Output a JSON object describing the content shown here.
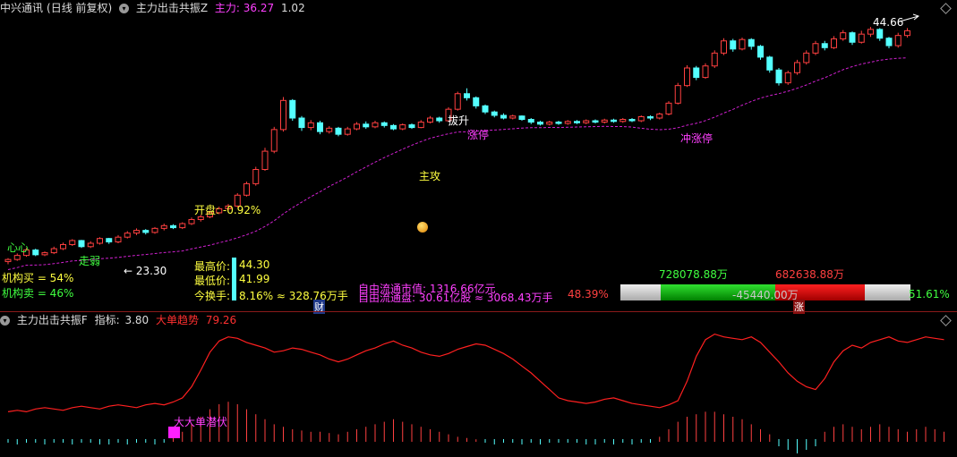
{
  "upper_header": {
    "stock": "中兴通讯",
    "period": "(日线 前复权)",
    "indicator": "主力出击共振Z",
    "line_label": "主力:",
    "line_value": "36.27",
    "ratio": "1.02"
  },
  "annotations": {
    "peak_price": "44.66",
    "low_price": "← 23.30",
    "xin": "心心",
    "zou_ruo": "走弱",
    "ba_sheng": "拔升",
    "zhang_ting_1": "涨停",
    "zhang_ting_2": "冲涨停",
    "zhu_gong": "主攻",
    "kai_pan": "开盘: -0.92%"
  },
  "info": {
    "inst_buy": "机构买 = 54%",
    "inst_sell": "机构卖 = 46%",
    "high_label": "最高价:",
    "high_value": "44.30",
    "low_label": "最低价:",
    "low_value": "41.99",
    "turnover_label": "今换手:",
    "turnover_value": "8.16% ≈ 328.76万手",
    "cai": "财",
    "float_cap": "自由流通市值: 1316.66亿元",
    "float_shares": "自由流通盘: 30.61亿股 ≈ 3068.43万手",
    "float_pct": "48.39%",
    "bar_green_value": "728078.88万",
    "bar_red_value": "682638.88万",
    "bar_center_value": "-45440.00万",
    "bar_pct": "51.61%",
    "zhang": "涨"
  },
  "lower_header": {
    "indicator": "主力出击共振F",
    "metric_label": "指标:",
    "metric_value": "3.80",
    "trend_label": "大单趋势",
    "trend_value": "79.26"
  },
  "lower_annotation": "大大单潜伏",
  "colors": {
    "up": "#ff4040",
    "down": "#54ffff",
    "ma": "#d020d0",
    "trend": "#ff2020",
    "yellow": "#ffff40",
    "magenta": "#ff40ff",
    "green": "#40ff40"
  },
  "candles": [
    [
      10.0,
      10.3,
      9.6,
      10.5
    ],
    [
      10.3,
      10.9,
      10.1,
      11.2
    ],
    [
      10.9,
      11.7,
      10.7,
      12.0
    ],
    [
      11.7,
      11.0,
      10.8,
      11.9
    ],
    [
      11.0,
      11.3,
      10.8,
      11.5
    ],
    [
      11.3,
      11.9,
      11.1,
      12.2
    ],
    [
      11.9,
      12.5,
      11.7,
      12.8
    ],
    [
      12.5,
      13.1,
      12.3,
      13.3
    ],
    [
      13.1,
      12.2,
      12.0,
      13.2
    ],
    [
      12.2,
      12.7,
      12.0,
      13.0
    ],
    [
      12.7,
      13.4,
      12.5,
      13.6
    ],
    [
      13.4,
      12.9,
      12.6,
      13.5
    ],
    [
      12.9,
      13.6,
      12.7,
      13.9
    ],
    [
      13.6,
      14.2,
      13.4,
      14.5
    ],
    [
      14.2,
      14.6,
      13.9,
      14.9
    ],
    [
      14.6,
      14.3,
      14.0,
      14.8
    ],
    [
      14.3,
      14.9,
      14.1,
      15.1
    ],
    [
      14.9,
      15.3,
      14.6,
      15.6
    ],
    [
      15.3,
      15.0,
      14.8,
      15.5
    ],
    [
      15.0,
      15.6,
      14.8,
      15.8
    ],
    [
      15.6,
      16.2,
      15.4,
      16.5
    ],
    [
      16.2,
      16.6,
      15.9,
      16.9
    ],
    [
      16.6,
      17.2,
      16.4,
      17.5
    ],
    [
      17.2,
      17.8,
      17.0,
      18.1
    ],
    [
      17.8,
      18.2,
      17.5,
      18.5
    ],
    [
      18.2,
      19.8,
      18.0,
      20.1
    ],
    [
      19.8,
      21.5,
      19.6,
      21.8
    ],
    [
      21.5,
      23.6,
      21.2,
      24.0
    ],
    [
      23.6,
      26.3,
      23.4,
      26.8
    ],
    [
      26.3,
      29.5,
      26.0,
      29.9
    ],
    [
      29.5,
      33.8,
      29.2,
      34.3
    ],
    [
      33.8,
      31.2,
      30.8,
      34.0
    ],
    [
      31.2,
      29.8,
      29.3,
      31.5
    ],
    [
      29.8,
      30.5,
      29.4,
      30.9
    ],
    [
      30.5,
      29.2,
      28.8,
      30.8
    ],
    [
      29.2,
      29.7,
      28.9,
      30.0
    ],
    [
      29.7,
      28.8,
      28.5,
      29.9
    ],
    [
      28.8,
      29.6,
      28.6,
      29.9
    ],
    [
      29.6,
      30.3,
      29.4,
      30.6
    ],
    [
      30.3,
      29.9,
      29.6,
      30.7
    ],
    [
      29.9,
      30.5,
      29.7,
      30.8
    ],
    [
      30.5,
      30.1,
      29.8,
      30.7
    ],
    [
      30.1,
      29.6,
      29.4,
      30.3
    ],
    [
      29.6,
      30.2,
      29.4,
      30.4
    ],
    [
      30.2,
      29.8,
      29.6,
      30.4
    ],
    [
      29.8,
      30.6,
      29.7,
      30.9
    ],
    [
      30.6,
      31.2,
      30.4,
      31.5
    ],
    [
      31.2,
      30.8,
      30.5,
      31.4
    ],
    [
      30.8,
      32.5,
      30.6,
      32.8
    ],
    [
      32.5,
      34.8,
      32.3,
      35.1
    ],
    [
      34.8,
      34.2,
      33.8,
      35.6
    ],
    [
      34.2,
      33.0,
      32.6,
      34.4
    ],
    [
      33.0,
      32.1,
      31.8,
      33.2
    ],
    [
      32.1,
      31.6,
      31.3,
      32.3
    ],
    [
      31.6,
      31.2,
      31.0,
      31.9
    ],
    [
      31.2,
      31.5,
      31.0,
      31.7
    ],
    [
      31.5,
      31.0,
      30.8,
      31.6
    ],
    [
      31.0,
      30.6,
      30.3,
      31.2
    ],
    [
      30.6,
      30.3,
      30.1,
      30.8
    ],
    [
      30.3,
      30.6,
      30.1,
      30.8
    ],
    [
      30.6,
      30.4,
      30.2,
      30.8
    ],
    [
      30.4,
      30.7,
      30.2,
      30.9
    ],
    [
      30.7,
      30.5,
      30.3,
      30.9
    ],
    [
      30.5,
      30.8,
      30.3,
      31.0
    ],
    [
      30.8,
      30.6,
      30.4,
      31.0
    ],
    [
      30.6,
      30.9,
      30.4,
      31.1
    ],
    [
      30.9,
      30.7,
      30.5,
      31.1
    ],
    [
      30.7,
      31.0,
      30.5,
      31.2
    ],
    [
      31.0,
      30.8,
      30.6,
      31.2
    ],
    [
      30.8,
      31.4,
      30.6,
      31.6
    ],
    [
      31.4,
      31.2,
      30.9,
      31.6
    ],
    [
      31.2,
      31.8,
      31.0,
      32.0
    ],
    [
      31.8,
      33.4,
      31.6,
      33.7
    ],
    [
      33.4,
      36.0,
      33.2,
      36.4
    ],
    [
      36.0,
      38.6,
      35.8,
      39.0
    ],
    [
      38.6,
      37.2,
      36.8,
      38.9
    ],
    [
      37.2,
      38.9,
      37.0,
      39.3
    ],
    [
      38.9,
      40.8,
      38.6,
      41.2
    ],
    [
      40.8,
      42.6,
      40.5,
      43.0
    ],
    [
      42.6,
      41.4,
      41.0,
      42.9
    ],
    [
      41.4,
      42.8,
      41.2,
      43.1
    ],
    [
      42.8,
      41.8,
      41.3,
      43.0
    ],
    [
      41.8,
      40.2,
      39.8,
      42.0
    ],
    [
      40.2,
      38.3,
      37.9,
      40.4
    ],
    [
      38.3,
      36.4,
      36.0,
      38.6
    ],
    [
      36.4,
      37.9,
      36.1,
      38.2
    ],
    [
      37.9,
      39.4,
      37.6,
      39.8
    ],
    [
      39.4,
      40.8,
      39.1,
      41.2
    ],
    [
      40.8,
      42.2,
      40.5,
      42.6
    ],
    [
      42.2,
      41.6,
      41.2,
      42.6
    ],
    [
      41.6,
      42.9,
      41.4,
      43.3
    ],
    [
      42.9,
      43.8,
      42.6,
      44.2
    ],
    [
      43.8,
      42.4,
      42.0,
      44.0
    ],
    [
      42.4,
      43.6,
      42.2,
      44.1
    ],
    [
      43.6,
      44.3,
      43.2,
      44.66
    ],
    [
      44.3,
      43.0,
      42.6,
      44.5
    ],
    [
      43.0,
      41.9,
      41.5,
      43.2
    ],
    [
      41.9,
      43.4,
      41.6,
      43.8
    ],
    [
      43.4,
      44.1,
      43.1,
      44.5
    ]
  ],
  "trend_line": [
    12,
    13,
    12,
    14,
    15,
    14,
    13,
    15,
    16,
    15,
    14,
    16,
    17,
    16,
    15,
    17,
    18,
    17,
    19,
    22,
    30,
    42,
    55,
    63,
    66,
    65,
    62,
    60,
    58,
    55,
    56,
    58,
    57,
    55,
    53,
    50,
    48,
    50,
    53,
    56,
    58,
    61,
    63,
    60,
    58,
    55,
    53,
    52,
    54,
    57,
    59,
    61,
    60,
    57,
    54,
    50,
    45,
    40,
    34,
    28,
    22,
    20,
    19,
    18,
    19,
    21,
    22,
    20,
    18,
    17,
    16,
    15,
    17,
    20,
    34,
    52,
    64,
    68,
    66,
    65,
    64,
    66,
    62,
    55,
    48,
    40,
    34,
    30,
    28,
    36,
    48,
    56,
    60,
    58,
    62,
    64,
    66,
    63,
    62,
    64,
    66,
    65,
    64
  ],
  "volume_bars": [
    -2,
    -3,
    -2,
    -2,
    -3,
    -2,
    -2,
    -3,
    -2,
    -2,
    -3,
    -3,
    -2,
    -3,
    -2,
    -2,
    -3,
    -2,
    5,
    8,
    14,
    20,
    26,
    30,
    32,
    30,
    26,
    22,
    18,
    14,
    12,
    10,
    9,
    8,
    8,
    7,
    6,
    8,
    10,
    12,
    14,
    16,
    18,
    16,
    14,
    12,
    10,
    8,
    6,
    4,
    3,
    2,
    -2,
    -3,
    -2,
    -2,
    -3,
    -2,
    -3,
    -2,
    -2,
    -2,
    -2,
    -3,
    -3,
    -2,
    -3,
    -2,
    -3,
    -2,
    -2,
    4,
    10,
    16,
    20,
    22,
    24,
    24,
    22,
    20,
    18,
    14,
    10,
    6,
    -4,
    -6,
    -8,
    -6,
    -4,
    8,
    12,
    14,
    12,
    10,
    12,
    14,
    12,
    10,
    8,
    10,
    12,
    10,
    8
  ]
}
